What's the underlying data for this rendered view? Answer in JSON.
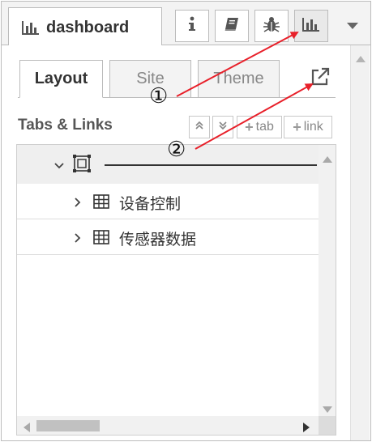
{
  "header": {
    "tab_title": "dashboard",
    "buttons": [
      {
        "name": "info-button",
        "icon": "info-icon"
      },
      {
        "name": "help-button",
        "icon": "book-icon"
      },
      {
        "name": "debug-button",
        "icon": "bug-icon"
      },
      {
        "name": "dashboard-button",
        "icon": "bar-chart-icon",
        "active": true
      }
    ]
  },
  "subtabs": {
    "layout": "Layout",
    "site": "Site",
    "theme": "Theme"
  },
  "section": {
    "title": "Tabs & Links",
    "add_tab_label": "tab",
    "add_link_label": "link"
  },
  "tree": {
    "items": [
      {
        "label": "设备控制"
      },
      {
        "label": "传感器数据"
      }
    ]
  },
  "annotations": {
    "one": "①",
    "two": "②"
  },
  "colors": {
    "arrow": "#e8202a",
    "active_bg": "#e9e9e9"
  }
}
